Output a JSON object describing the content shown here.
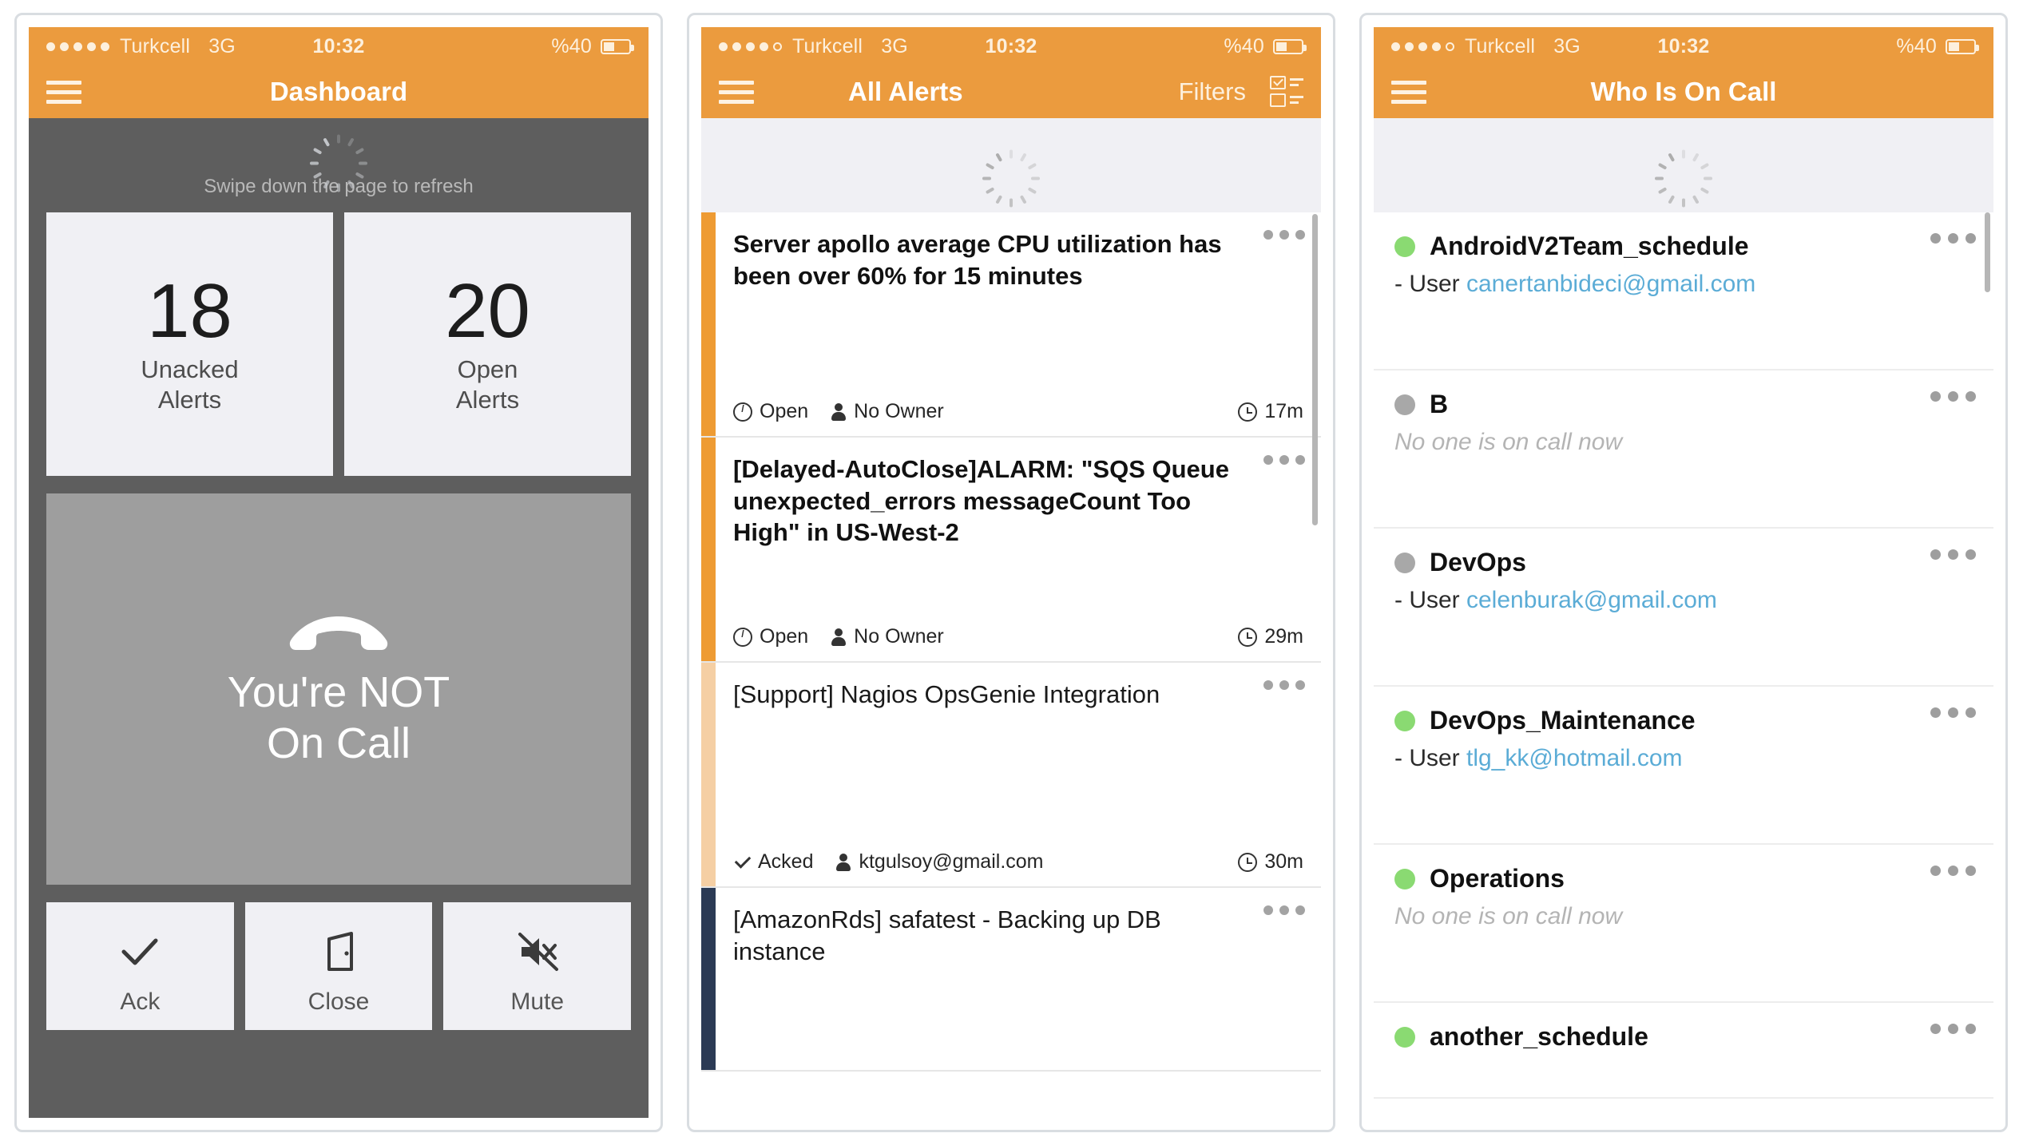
{
  "colors": {
    "accent_orange": "#eb9b3e",
    "dash_bg": "#5e5e5e",
    "card_bg": "#f0f0f4",
    "oncall_bg": "#9e9e9e",
    "link_blue": "#5bacd6",
    "green_dot": "#8ada72",
    "grey_dot": "#a8a8a8",
    "alert_bar_orange": "#ee9b33",
    "alert_bar_peach": "#f5cfa4",
    "alert_bar_navy": "#2b3a55"
  },
  "statusbar": {
    "carrier": "Turkcell",
    "network": "3G",
    "time": "10:32",
    "battery": "%40",
    "signal_dots_filled_1": 5,
    "signal_dots_filled_2": 4,
    "signal_dots_filled_3": 4,
    "signal_dots_total": 5
  },
  "panel1": {
    "nav_title": "Dashboard",
    "menu_icon": "hamburger-icon",
    "refresh_text": "Swipe down the page to refresh",
    "spinner_icon": "loading-spinner-icon",
    "stats": [
      {
        "value": "18",
        "label_line1": "Unacked",
        "label_line2": "Alerts"
      },
      {
        "value": "20",
        "label_line1": "Open",
        "label_line2": "Alerts"
      }
    ],
    "oncall_icon": "phone-hangup-icon",
    "oncall_line1": "You're NOT",
    "oncall_line2": "On Call",
    "actions": [
      {
        "label": "Ack",
        "icon": "check-icon"
      },
      {
        "label": "Close",
        "icon": "door-icon"
      },
      {
        "label": "Mute",
        "icon": "mute-icon"
      }
    ]
  },
  "panel2": {
    "nav_title": "All Alerts",
    "menu_icon": "hamburger-icon",
    "filters_label": "Filters",
    "list_icon": "checklist-icon",
    "spinner_icon": "loading-spinner-icon",
    "alerts": [
      {
        "title": "Server apollo average CPU utilization has been over 60% for 15 minutes",
        "status": "Open",
        "status_icon": "info-icon",
        "owner": "No Owner",
        "owner_icon": "user-icon",
        "age": "17m",
        "age_icon": "clock-icon",
        "bar_color": "#ee9b33",
        "bold": true,
        "more_icon": "more-options-icon"
      },
      {
        "title": "[Delayed-AutoClose]ALARM: \"SQS Queue unexpected_errors messageCount Too High\" in US-West-2",
        "status": "Open",
        "status_icon": "info-icon",
        "owner": "No Owner",
        "owner_icon": "user-icon",
        "age": "29m",
        "age_icon": "clock-icon",
        "bar_color": "#ee9b33",
        "bold": true,
        "more_icon": "more-options-icon"
      },
      {
        "title": "[Support] Nagios OpsGenie Integration",
        "status": "Acked",
        "status_icon": "check-icon",
        "owner": "ktgulsoy@gmail.com",
        "owner_icon": "user-icon",
        "age": "30m",
        "age_icon": "clock-icon",
        "bar_color": "#f5cfa4",
        "bold": false,
        "more_icon": "more-options-icon"
      },
      {
        "title": "[AmazonRds] safatest - Backing up DB instance",
        "status": "",
        "status_icon": "",
        "owner": "",
        "owner_icon": "",
        "age": "",
        "age_icon": "",
        "bar_color": "#2b3a55",
        "bold": false,
        "more_icon": "more-options-icon"
      }
    ]
  },
  "panel3": {
    "nav_title": "Who Is On Call",
    "menu_icon": "hamburger-icon",
    "spinner_icon": "loading-spinner-icon",
    "user_prefix": "- User ",
    "schedules": [
      {
        "name": "AndroidV2Team_schedule",
        "dot": "green",
        "user": "canertanbideci@gmail.com",
        "empty_text": "",
        "more_icon": "more-options-icon"
      },
      {
        "name": "B",
        "dot": "grey",
        "user": "",
        "empty_text": "No one is on call now",
        "more_icon": "more-options-icon"
      },
      {
        "name": "DevOps",
        "dot": "grey",
        "user": "celenburak@gmail.com",
        "empty_text": "",
        "more_icon": "more-options-icon"
      },
      {
        "name": "DevOps_Maintenance",
        "dot": "green",
        "user": "tlg_kk@hotmail.com",
        "empty_text": "",
        "more_icon": "more-options-icon"
      },
      {
        "name": "Operations",
        "dot": "green",
        "user": "",
        "empty_text": "No one is on call now",
        "more_icon": "more-options-icon"
      },
      {
        "name": "another_schedule",
        "dot": "green",
        "user": "",
        "empty_text": "",
        "more_icon": "more-options-icon"
      }
    ]
  }
}
